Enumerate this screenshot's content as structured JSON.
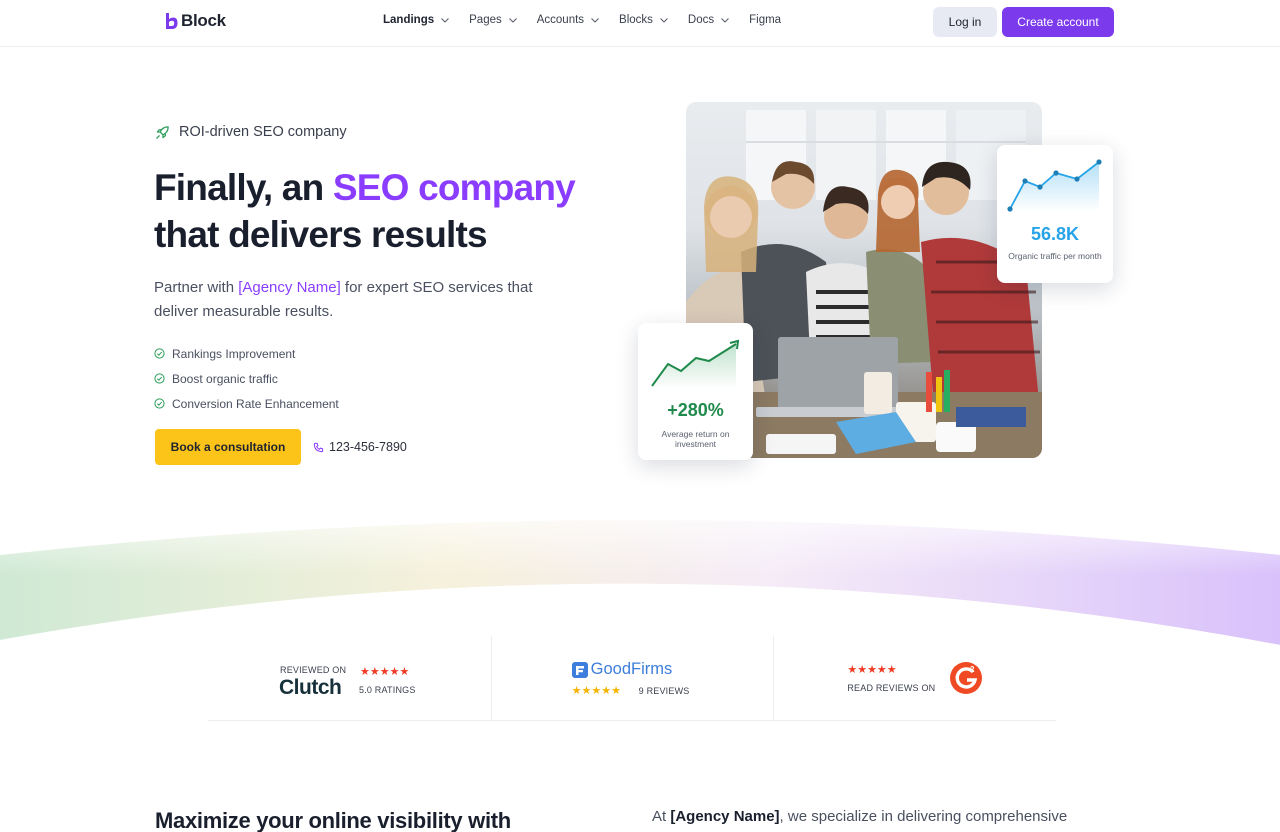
{
  "brand": {
    "name": "Block",
    "accent": "#7c3aed"
  },
  "nav": {
    "items": [
      {
        "label": "Landings",
        "has_dropdown": true
      },
      {
        "label": "Pages",
        "has_dropdown": true
      },
      {
        "label": "Accounts",
        "has_dropdown": true
      },
      {
        "label": "Blocks",
        "has_dropdown": true
      },
      {
        "label": "Docs",
        "has_dropdown": true
      },
      {
        "label": "Figma",
        "has_dropdown": false
      }
    ],
    "login_label": "Log in",
    "create_label": "Create account"
  },
  "hero": {
    "eyebrow": "ROI-driven SEO company",
    "title_part1": "Finally, an ",
    "title_accent": "SEO company",
    "title_part2": "that delivers results",
    "desc_part1": "Partner with ",
    "desc_agency": "[Agency Name]",
    "desc_part2": " for expert SEO services that deliver measurable results.",
    "features": [
      "Rankings Improvement",
      "Boost organic traffic",
      "Conversion Rate Enhancement"
    ],
    "cta_label": "Book a consultation",
    "phone": "123-456-7890",
    "cta_color": "#fcc419"
  },
  "stats": {
    "traffic": {
      "value": "56.8K",
      "label": "Organic traffic per month",
      "color": "#27a4e8"
    },
    "roi": {
      "value": "+280%",
      "label": "Average return on investment",
      "color": "#1f8a4c"
    }
  },
  "reviews": {
    "clutch": {
      "reviewed_on": "REVIEWED ON",
      "brand": "Clutch",
      "stars": "★★★★★",
      "ratings": "5.0 RATINGS"
    },
    "goodfirms": {
      "brand": "GoodFirms",
      "stars": "★★★★★",
      "reviews": "9 REVIEWS"
    },
    "g2": {
      "stars": "★★★★★",
      "read_on": "READ REVIEWS ON"
    }
  },
  "section": {
    "title": "Maximize your online visibility with",
    "text_part1": "At ",
    "text_agency": "[Agency Name]",
    "text_part2": ", we specialize in delivering comprehensive"
  }
}
